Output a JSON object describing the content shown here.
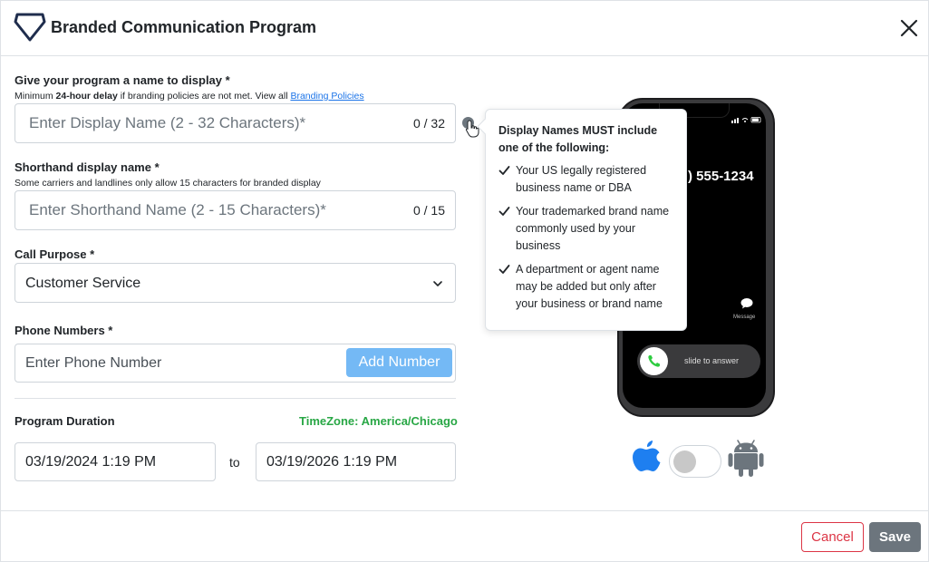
{
  "header": {
    "title": "Branded Communication Program",
    "logo_icon": "diamond-logo-icon",
    "close_icon": "close-icon"
  },
  "display_name": {
    "label": "Give your program a name to display *",
    "hint_prefix": "Minimum ",
    "hint_bold": "24-hour delay",
    "hint_middle": " if branding policies are not met. View all ",
    "hint_link": "Branding Policies",
    "value": "",
    "placeholder": "Enter Display Name (2 - 32 Characters)*",
    "counter": "0 / 32"
  },
  "shorthand_name": {
    "label": "Shorthand display name *",
    "hint": "Some carriers and landlines only allow 15 characters for branded display",
    "value": "",
    "placeholder": "Enter Shorthand Name (2 - 15 Characters)*",
    "counter": "0 / 15"
  },
  "call_purpose": {
    "label": "Call Purpose *",
    "selected": "Customer Service"
  },
  "phone_numbers": {
    "label": "Phone Numbers *",
    "value": "",
    "placeholder": "Enter Phone Number",
    "add_button": "Add Number"
  },
  "duration": {
    "label": "Program Duration",
    "timezone": "TimeZone: America/Chicago",
    "start": "03/19/2024 1:19 PM",
    "separator": "to",
    "end": "03/19/2026 1:19 PM"
  },
  "tooltip": {
    "title": "Display Names MUST include one of the following:",
    "items": [
      "Your US legally registered business name or DBA",
      "Your trademarked brand name commonly used by your business",
      "A department or agent name may be added but only after your business or brand name"
    ]
  },
  "phone_preview": {
    "caller_number": ") 555-1234",
    "message_label": "Message",
    "slide_text": "slide to answer"
  },
  "os_toggle": {
    "left_icon": "apple-icon",
    "right_icon": "android-icon",
    "selected": "apple"
  },
  "footer": {
    "cancel": "Cancel",
    "save": "Save"
  },
  "colors": {
    "accent_blue": "#74b9f5",
    "link_blue": "#1a73e8",
    "timezone_green": "#28a745",
    "cancel_red": "#dc3545",
    "save_gray": "#6c757d",
    "logo_navy": "#1f2d4d"
  }
}
